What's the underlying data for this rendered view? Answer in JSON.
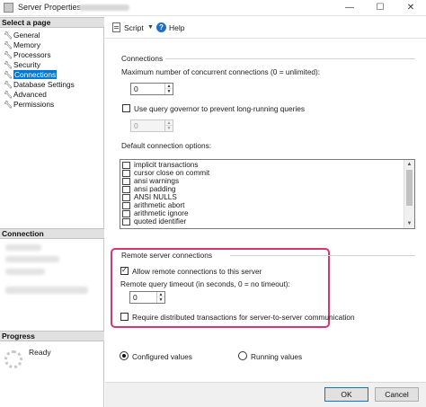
{
  "window": {
    "title": "Server Properties -",
    "minimize_glyph": "—",
    "maximize_glyph": "☐",
    "close_glyph": "✕"
  },
  "left_pane": {
    "select_page_header": "Select a page",
    "pages": [
      {
        "label": "General",
        "icon": "wrench-icon"
      },
      {
        "label": "Memory",
        "icon": "wrench-icon"
      },
      {
        "label": "Processors",
        "icon": "wrench-icon"
      },
      {
        "label": "Security",
        "icon": "wrench-icon"
      },
      {
        "label": "Connections",
        "icon": "wrench-icon",
        "selected": true
      },
      {
        "label": "Database Settings",
        "icon": "wrench-icon"
      },
      {
        "label": "Advanced",
        "icon": "wrench-icon"
      },
      {
        "label": "Permissions",
        "icon": "wrench-icon"
      }
    ],
    "connection_header": "Connection",
    "progress_header": "Progress",
    "progress_status": "Ready"
  },
  "toolbar": {
    "script_label": "Script",
    "help_label": "Help"
  },
  "connections": {
    "group_label": "Connections",
    "max_connections_label": "Maximum number of concurrent connections (0 = unlimited):",
    "max_connections_value": "0",
    "query_governor_label": "Use query governor to prevent long-running queries",
    "query_governor_checked": false,
    "query_governor_value": "0",
    "default_options_label": "Default connection options:",
    "default_options": [
      {
        "label": "implicit transactions",
        "checked": false
      },
      {
        "label": "cursor close on commit",
        "checked": false
      },
      {
        "label": "ansi warnings",
        "checked": false
      },
      {
        "label": "ansi padding",
        "checked": false
      },
      {
        "label": "ANSI NULLS",
        "checked": false
      },
      {
        "label": "arithmetic abort",
        "checked": false
      },
      {
        "label": "arithmetic ignore",
        "checked": false
      },
      {
        "label": "quoted identifier",
        "checked": false
      }
    ]
  },
  "remote": {
    "group_label": "Remote server connections",
    "allow_remote_label": "Allow remote connections to this server",
    "allow_remote_checked": true,
    "timeout_label": "Remote query timeout (in seconds, 0 = no timeout):",
    "timeout_value": "0",
    "distributed_label": "Require distributed transactions for server-to-server communication",
    "distributed_checked": false,
    "highlight_color": "#e0336a"
  },
  "values_mode": {
    "configured_label": "Configured values",
    "running_label": "Running values",
    "selected": "configured"
  },
  "footer": {
    "ok_label": "OK",
    "cancel_label": "Cancel"
  }
}
